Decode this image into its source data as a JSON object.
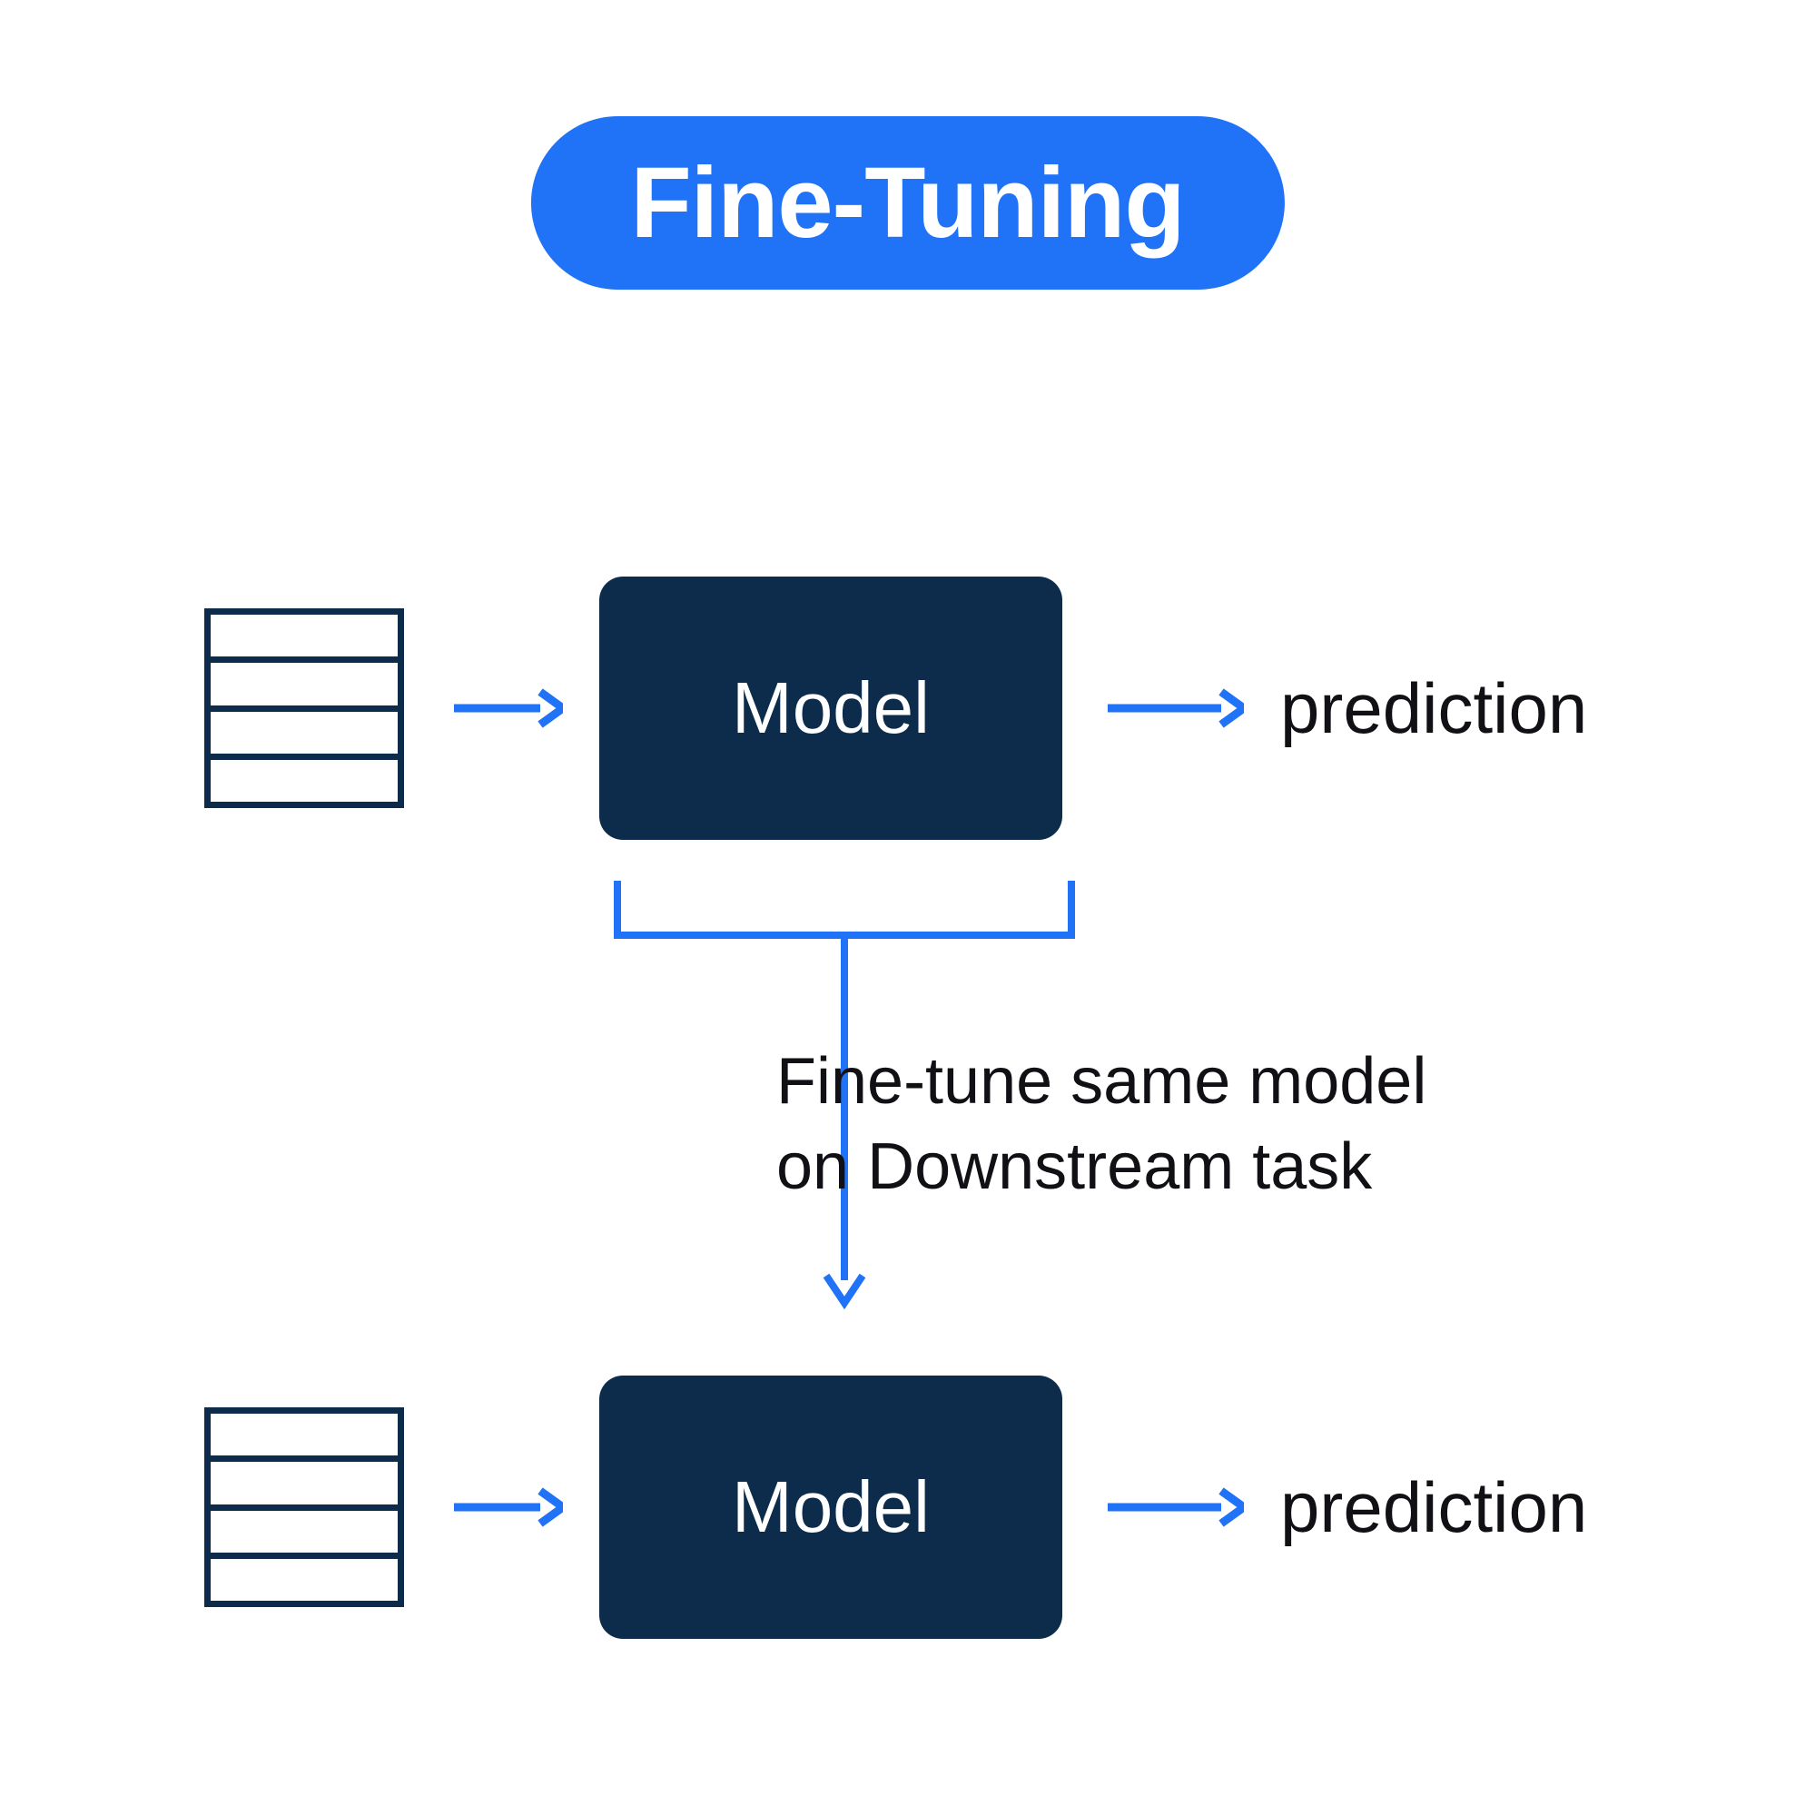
{
  "title": "Fine-Tuning",
  "row1": {
    "model_label": "Model",
    "output_label": "prediction"
  },
  "row2": {
    "model_label": "Model",
    "output_label": "prediction"
  },
  "caption": "Fine-tune same model\non Downstream task",
  "colors": {
    "accent": "#2073f7",
    "dark": "#0d2c4c"
  }
}
